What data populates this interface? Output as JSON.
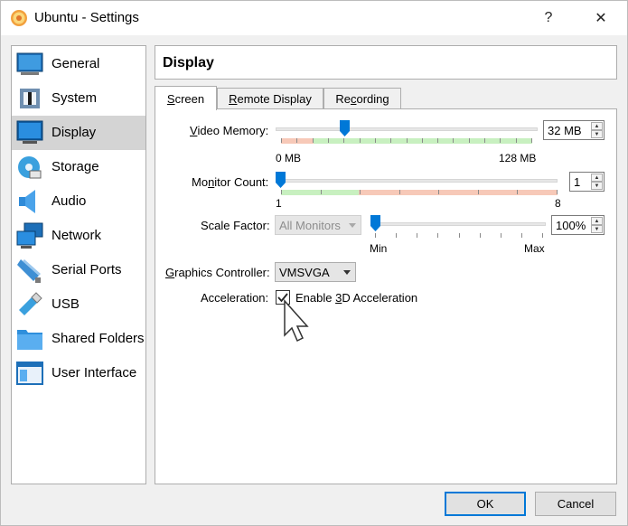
{
  "window": {
    "title": "Ubuntu - Settings",
    "help_glyph": "?",
    "close_glyph": "✕"
  },
  "sidebar": {
    "items": [
      {
        "label": "General",
        "icon": "monitor-icon"
      },
      {
        "label": "System",
        "icon": "chip-icon"
      },
      {
        "label": "Display",
        "icon": "display-icon",
        "selected": true
      },
      {
        "label": "Storage",
        "icon": "disk-icon"
      },
      {
        "label": "Audio",
        "icon": "speaker-icon"
      },
      {
        "label": "Network",
        "icon": "network-icon"
      },
      {
        "label": "Serial Ports",
        "icon": "serial-port-icon"
      },
      {
        "label": "USB",
        "icon": "usb-icon"
      },
      {
        "label": "Shared Folders",
        "icon": "folder-icon"
      },
      {
        "label": "User Interface",
        "icon": "window-icon"
      }
    ]
  },
  "header": {
    "title": "Display"
  },
  "tabs": [
    {
      "label": "Screen",
      "active": true
    },
    {
      "label": "Remote Display"
    },
    {
      "label": "Recording"
    }
  ],
  "screen": {
    "video_memory": {
      "label": "Video Memory:",
      "value": "32 MB",
      "value_mb": 32,
      "min_label": "0 MB",
      "max_label": "128 MB"
    },
    "monitor_count": {
      "label": "Monitor Count:",
      "value": "1",
      "min_label": "1",
      "max_label": "8"
    },
    "scale_factor": {
      "label": "Scale Factor:",
      "monitor_select": "All Monitors",
      "value": "100%",
      "min_label": "Min",
      "max_label": "Max"
    },
    "graphics_controller": {
      "label": "Graphics Controller:",
      "value": "VMSVGA"
    },
    "acceleration": {
      "label": "Acceleration:",
      "checkbox_label": "Enable 3D Acceleration",
      "checked": true
    }
  },
  "buttons": {
    "ok": "OK",
    "cancel": "Cancel"
  },
  "colors": {
    "accent": "#0078d7",
    "zone_green": "#c8f0c0",
    "zone_red": "#f7c9b8",
    "selected_bg": "#d4d4d4"
  }
}
